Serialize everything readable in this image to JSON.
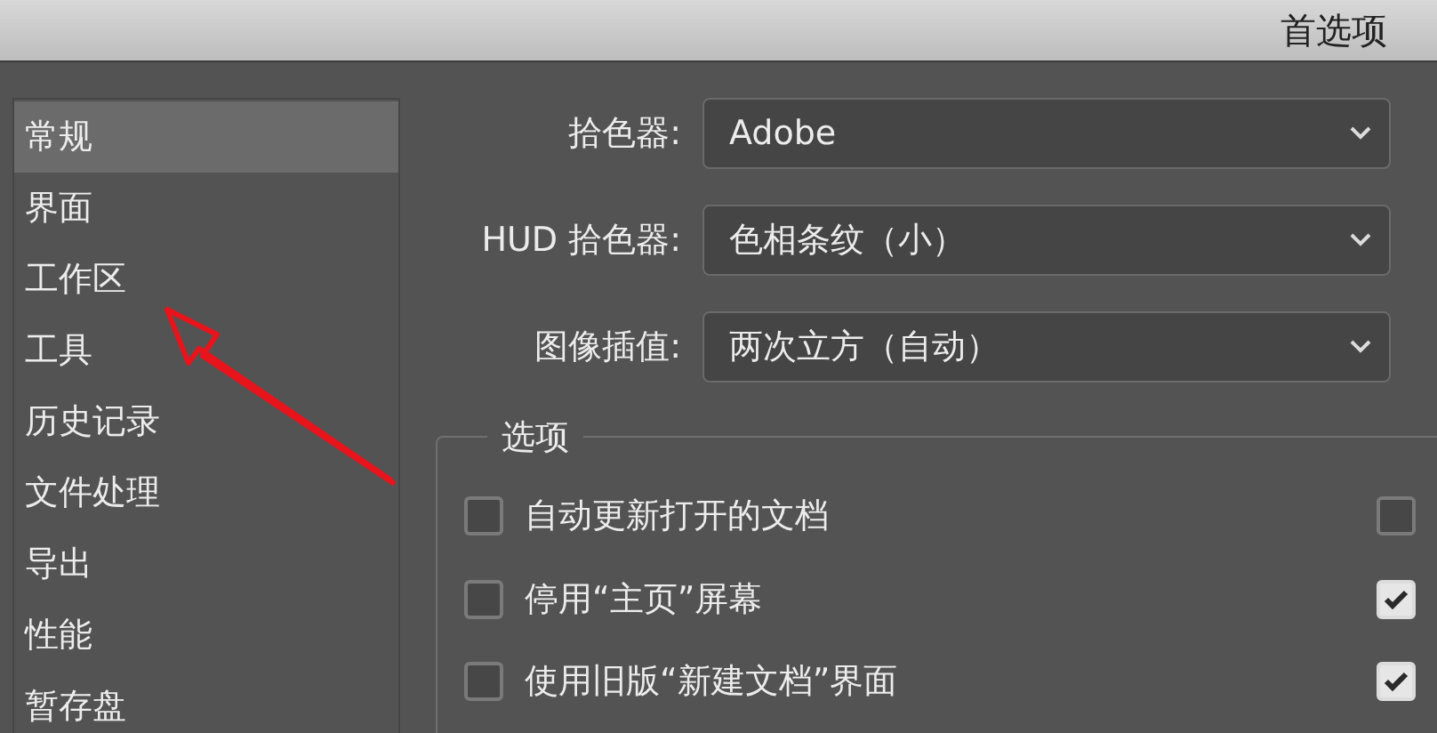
{
  "window": {
    "title": "首选项"
  },
  "sidebar": {
    "items": [
      {
        "label": "常规",
        "selected": true
      },
      {
        "label": "界面",
        "selected": false
      },
      {
        "label": "工作区",
        "selected": false
      },
      {
        "label": "工具",
        "selected": false
      },
      {
        "label": "历史记录",
        "selected": false
      },
      {
        "label": "文件处理",
        "selected": false
      },
      {
        "label": "导出",
        "selected": false
      },
      {
        "label": "性能",
        "selected": false
      },
      {
        "label": "暂存盘",
        "selected": false
      }
    ]
  },
  "fields": [
    {
      "label": "拾色器:",
      "value": "Adobe"
    },
    {
      "label": "HUD 拾色器:",
      "value": "色相条纹（小）"
    },
    {
      "label": "图像插值:",
      "value": "两次立方（自动）"
    }
  ],
  "options": {
    "title": "选项",
    "items": [
      {
        "label": "自动更新打开的文档",
        "checked": false,
        "right_checked": false
      },
      {
        "label": "停用“主页”屏幕",
        "checked": false,
        "right_checked": true
      },
      {
        "label": "使用旧版“新建文档”界面",
        "checked": false,
        "right_checked": true
      }
    ]
  }
}
